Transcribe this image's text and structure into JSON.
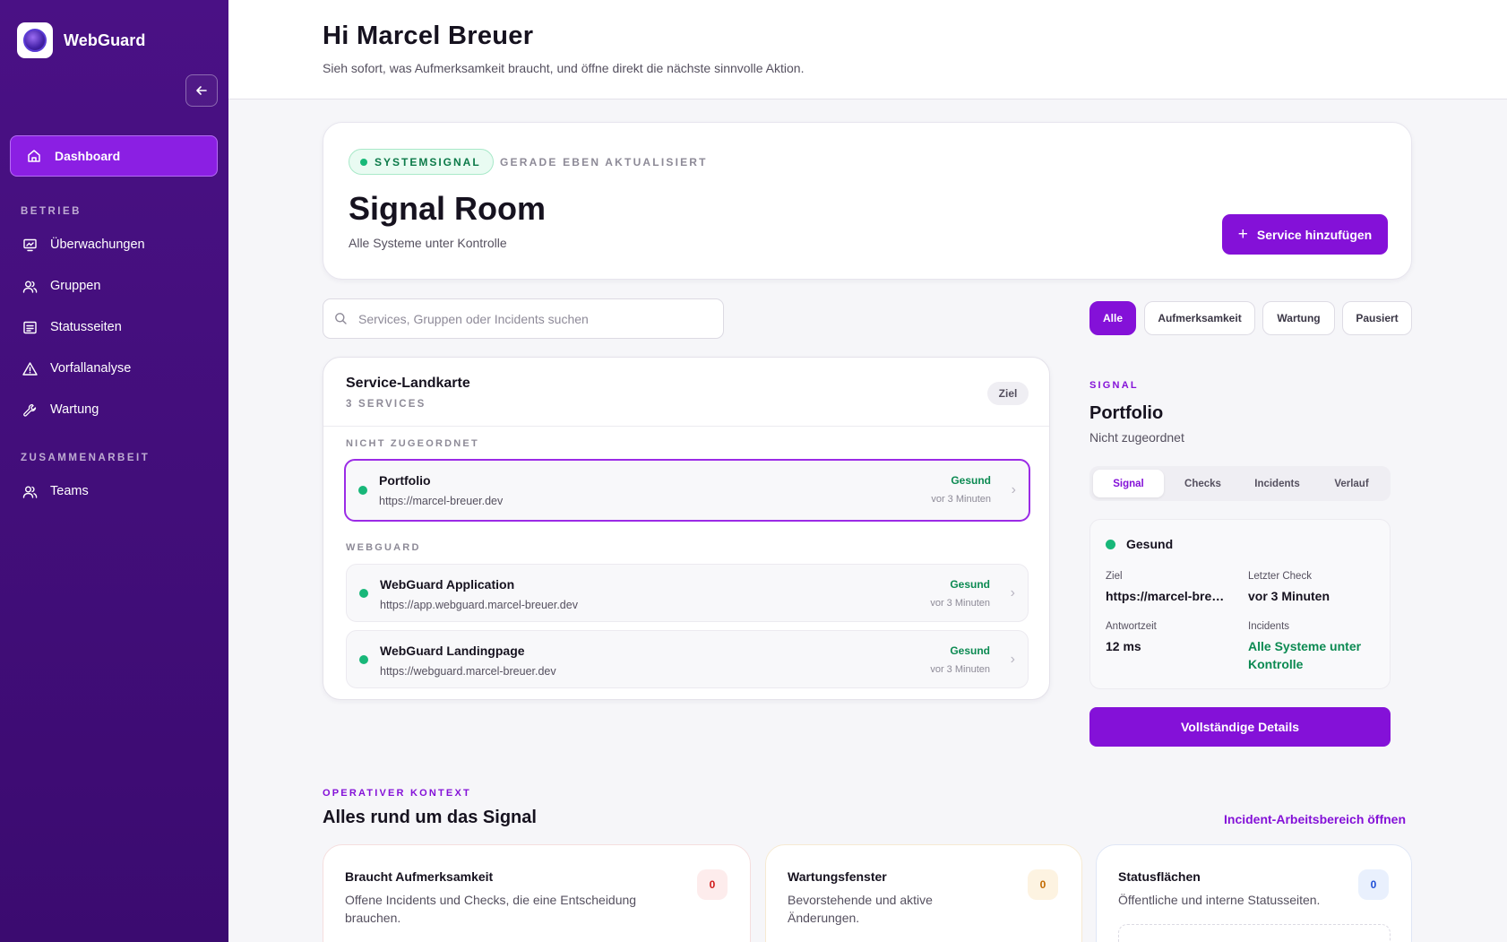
{
  "app": {
    "name": "WebGuard"
  },
  "sidebar": {
    "active": "Dashboard",
    "sections": [
      "BETRIEB",
      "ZUSAMMENARBEIT"
    ],
    "items": [
      "Überwachungen",
      "Gruppen",
      "Statusseiten",
      "Vorfallanalyse",
      "Wartung",
      "Teams"
    ]
  },
  "header": {
    "title": "Hi Marcel Breuer",
    "subtitle": "Sieh sofort, was Aufmerksamkeit braucht, und öffne direkt die nächste sinnvolle Aktion."
  },
  "hero": {
    "badge": "SYSTEMSIGNAL",
    "updated": "GERADE EBEN AKTUALISIERT",
    "title": "Signal Room",
    "subtitle": "Alle Systeme unter Kontrolle",
    "add_button": "Service hinzufügen"
  },
  "search": {
    "placeholder": "Services, Gruppen oder Incidents suchen"
  },
  "filters": [
    "Alle",
    "Aufmerksamkeit",
    "Wartung",
    "Pausiert"
  ],
  "service_map": {
    "title": "Service-Landkarte",
    "count": "3 SERVICES",
    "badge": "Ziel",
    "groups": [
      {
        "label": "NICHT ZUGEORDNET",
        "services": [
          {
            "name": "Portfolio",
            "url": "https://marcel-breuer.dev",
            "status": "Gesund",
            "time": "vor 3 Minuten"
          }
        ]
      },
      {
        "label": "WEBGUARD",
        "services": [
          {
            "name": "WebGuard Application",
            "url": "https://app.webguard.marcel-breuer.dev",
            "status": "Gesund",
            "time": "vor 3 Minuten"
          },
          {
            "name": "WebGuard Landingpage",
            "url": "https://webguard.marcel-breuer.dev",
            "status": "Gesund",
            "time": "vor 3 Minuten"
          }
        ]
      }
    ]
  },
  "signal_panel": {
    "label": "SIGNAL",
    "title": "Portfolio",
    "subtitle": "Nicht zugeordnet",
    "tabs": [
      "Signal",
      "Checks",
      "Incidents",
      "Verlauf"
    ],
    "health": "Gesund",
    "fields": {
      "ziel_label": "Ziel",
      "ziel_value": "https://marcel-breuer.dev",
      "last_check_label": "Letzter Check",
      "last_check_value": "vor 3 Minuten",
      "response_label": "Antwortzeit",
      "response_value": "12 ms",
      "incidents_label": "Incidents",
      "incidents_value": "Alle Systeme unter Kontrolle"
    },
    "details_button": "Vollständige Details"
  },
  "context": {
    "label": "OPERATIVER KONTEXT",
    "title": "Alles rund um das Signal",
    "link": "Incident-Arbeitsbereich öffnen",
    "cards": [
      {
        "title": "Braucht Aufmerksamkeit",
        "desc": "Offene Incidents und Checks, die eine Entscheidung brauchen.",
        "count": "0"
      },
      {
        "title": "Wartungsfenster",
        "desc": "Bevorstehende und aktive Änderungen.",
        "count": "0"
      },
      {
        "title": "Statusflächen",
        "desc": "Öffentliche und interne Statusseiten.",
        "count": "0"
      }
    ]
  },
  "colors": {
    "accent": "#8411d8",
    "sidebar": "#4a1185",
    "healthy": "#18b779"
  }
}
